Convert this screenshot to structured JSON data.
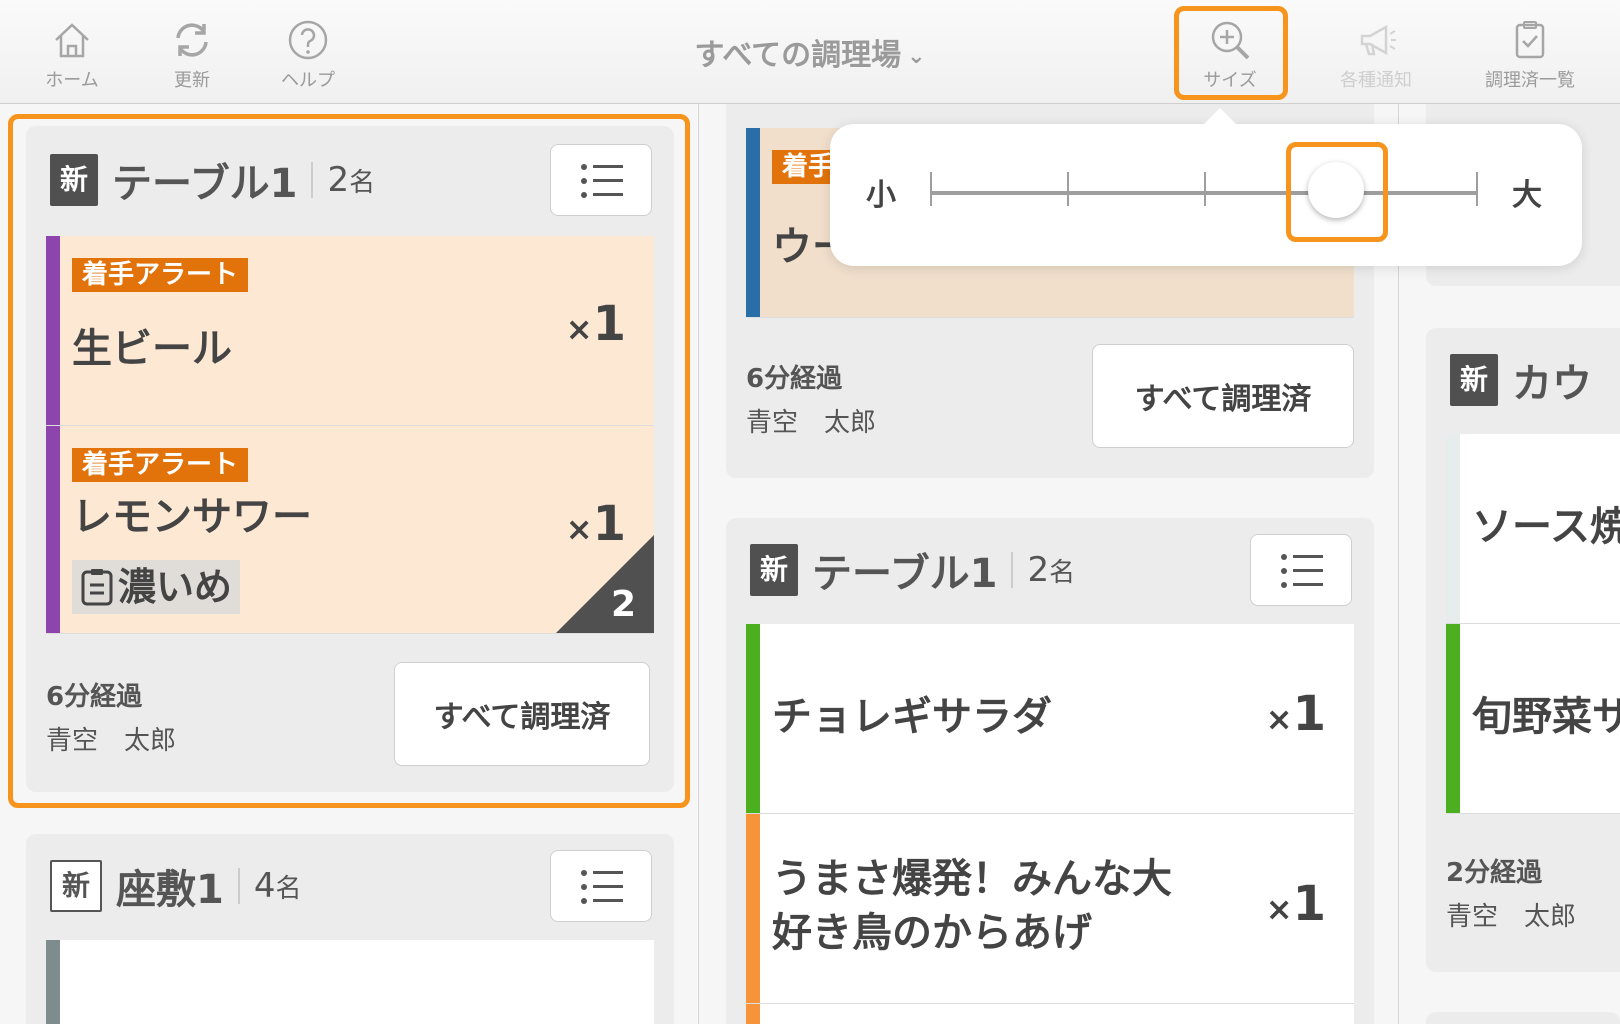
{
  "toolbar": {
    "home_label": "ホーム",
    "refresh_label": "更新",
    "help_label": "ヘルプ",
    "kitchen_selector": "すべての調理場",
    "size_label": "サイズ",
    "notify_label": "各種通知",
    "cooked_list_label": "調理済一覧"
  },
  "size_popover": {
    "small_label": "小",
    "large_label": "大",
    "level": 4,
    "steps": 5
  },
  "cards": {
    "c1": {
      "badge": "新",
      "table": "テーブル1",
      "guests": "2",
      "guests_unit": "名",
      "items": [
        {
          "tag": "着手アラート",
          "name": "生ビール",
          "qty": "1",
          "x": "×"
        },
        {
          "tag": "着手アラート",
          "name": "レモンサワー",
          "note": "濃いめ",
          "qty": "1",
          "x": "×",
          "count": "2"
        }
      ],
      "elapsed": "6分経過",
      "staff": "青空　太郎",
      "done": "すべて調理済"
    },
    "c2": {
      "badge": "新",
      "table": "座敷1",
      "guests": "4",
      "guests_unit": "名"
    },
    "c3": {
      "tag": "着手",
      "name": "ウー",
      "elapsed": "6分経過",
      "staff": "青空　太郎",
      "done": "すべて調理済"
    },
    "c4": {
      "badge": "新",
      "table": "テーブル1",
      "guests": "2",
      "guests_unit": "名",
      "items": [
        {
          "name": "チョレギサラダ",
          "qty": "1",
          "x": "×"
        },
        {
          "name": "うまさ爆発！みんな大好き鳥のからあげ",
          "qty": "1",
          "x": "×"
        }
      ]
    },
    "c5": {
      "badge": "新",
      "table": "カウ",
      "items": [
        {
          "name": "ソース焼"
        },
        {
          "name": "旬野菜サ"
        }
      ],
      "elapsed": "2分経過",
      "staff": "青空　太郎"
    }
  }
}
